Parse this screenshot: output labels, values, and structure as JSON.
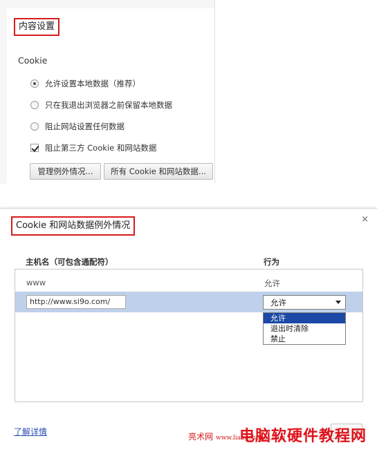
{
  "content_settings": {
    "title": "内容设置",
    "section": "Cookie",
    "options": [
      {
        "label": "允许设置本地数据（推荐）",
        "selected": true
      },
      {
        "label": "只在我退出浏览器之前保留本地数据",
        "selected": false
      },
      {
        "label": "阻止网站设置任何数据",
        "selected": false
      }
    ],
    "block_third_party_label": "阻止第三方 Cookie 和网站数据",
    "block_third_party_checked": true,
    "manage_exceptions_button": "管理例外情况...",
    "all_cookies_button": "所有 Cookie 和网站数据..."
  },
  "exceptions_dialog": {
    "title": "Cookie 和网站数据例外情况",
    "close_glyph": "×",
    "columns": {
      "host": "主机名（可包含通配符）",
      "action": "行为"
    },
    "rows": [
      {
        "host": "www",
        "action": "允许"
      }
    ],
    "new_host_value": "http://www.si9o.com/",
    "action_select_value": "允许",
    "action_options": [
      "允许",
      "退出时清除",
      "禁止"
    ],
    "learn_more_link": "了解详情"
  },
  "watermark": {
    "site": "亮术网",
    "url": "www.liangshunet.com",
    "brand": "电脑软硬件教程网"
  },
  "colors": {
    "highlight_border": "#d61b1b",
    "selected_row": "#bfd1ea",
    "selected_option": "#1b49a5",
    "link": "#2a4fb0"
  }
}
